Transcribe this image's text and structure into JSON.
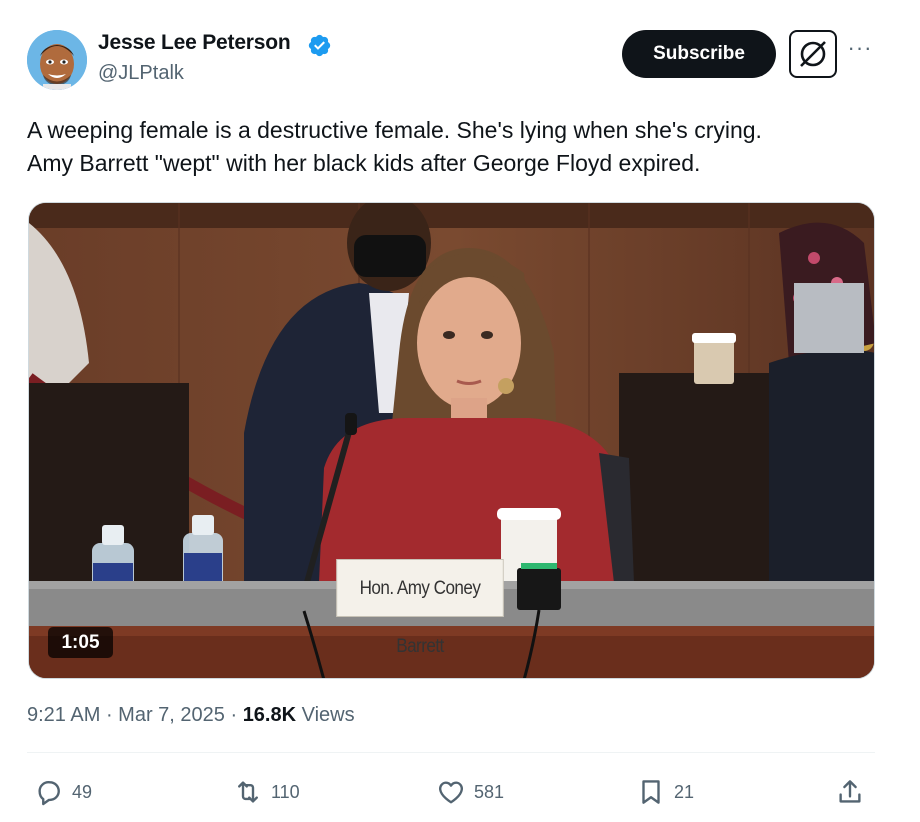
{
  "author": {
    "display_name": "Jesse Lee Peterson",
    "handle": "@JLPtalk",
    "verified": true,
    "avatar_icon": "cartoon-man-avatar"
  },
  "header_actions": {
    "subscribe_label": "Subscribe",
    "grok_icon": "grok-icon",
    "more_icon": "more-dots-icon",
    "more_label": "···"
  },
  "tweet": {
    "text": "A weeping female is a destructive female. She's lying when she's crying.\nAmy Barrett \"wept\" with her black kids after George Floyd expired."
  },
  "media": {
    "type": "video",
    "duration": "1:05",
    "nameplate": "Hon. Amy Coney Barrett"
  },
  "meta": {
    "time": "9:21 AM",
    "separator": " · ",
    "date": "Mar 7, 2025",
    "views_count": "16.8K",
    "views_label": "Views"
  },
  "actions": {
    "replies": "49",
    "retweets": "110",
    "likes": "581",
    "bookmarks": "21"
  },
  "colors": {
    "text_primary": "#0f1419",
    "text_secondary": "#536471",
    "verified_blue": "#1d9bf0",
    "divider": "#eff3f4"
  }
}
